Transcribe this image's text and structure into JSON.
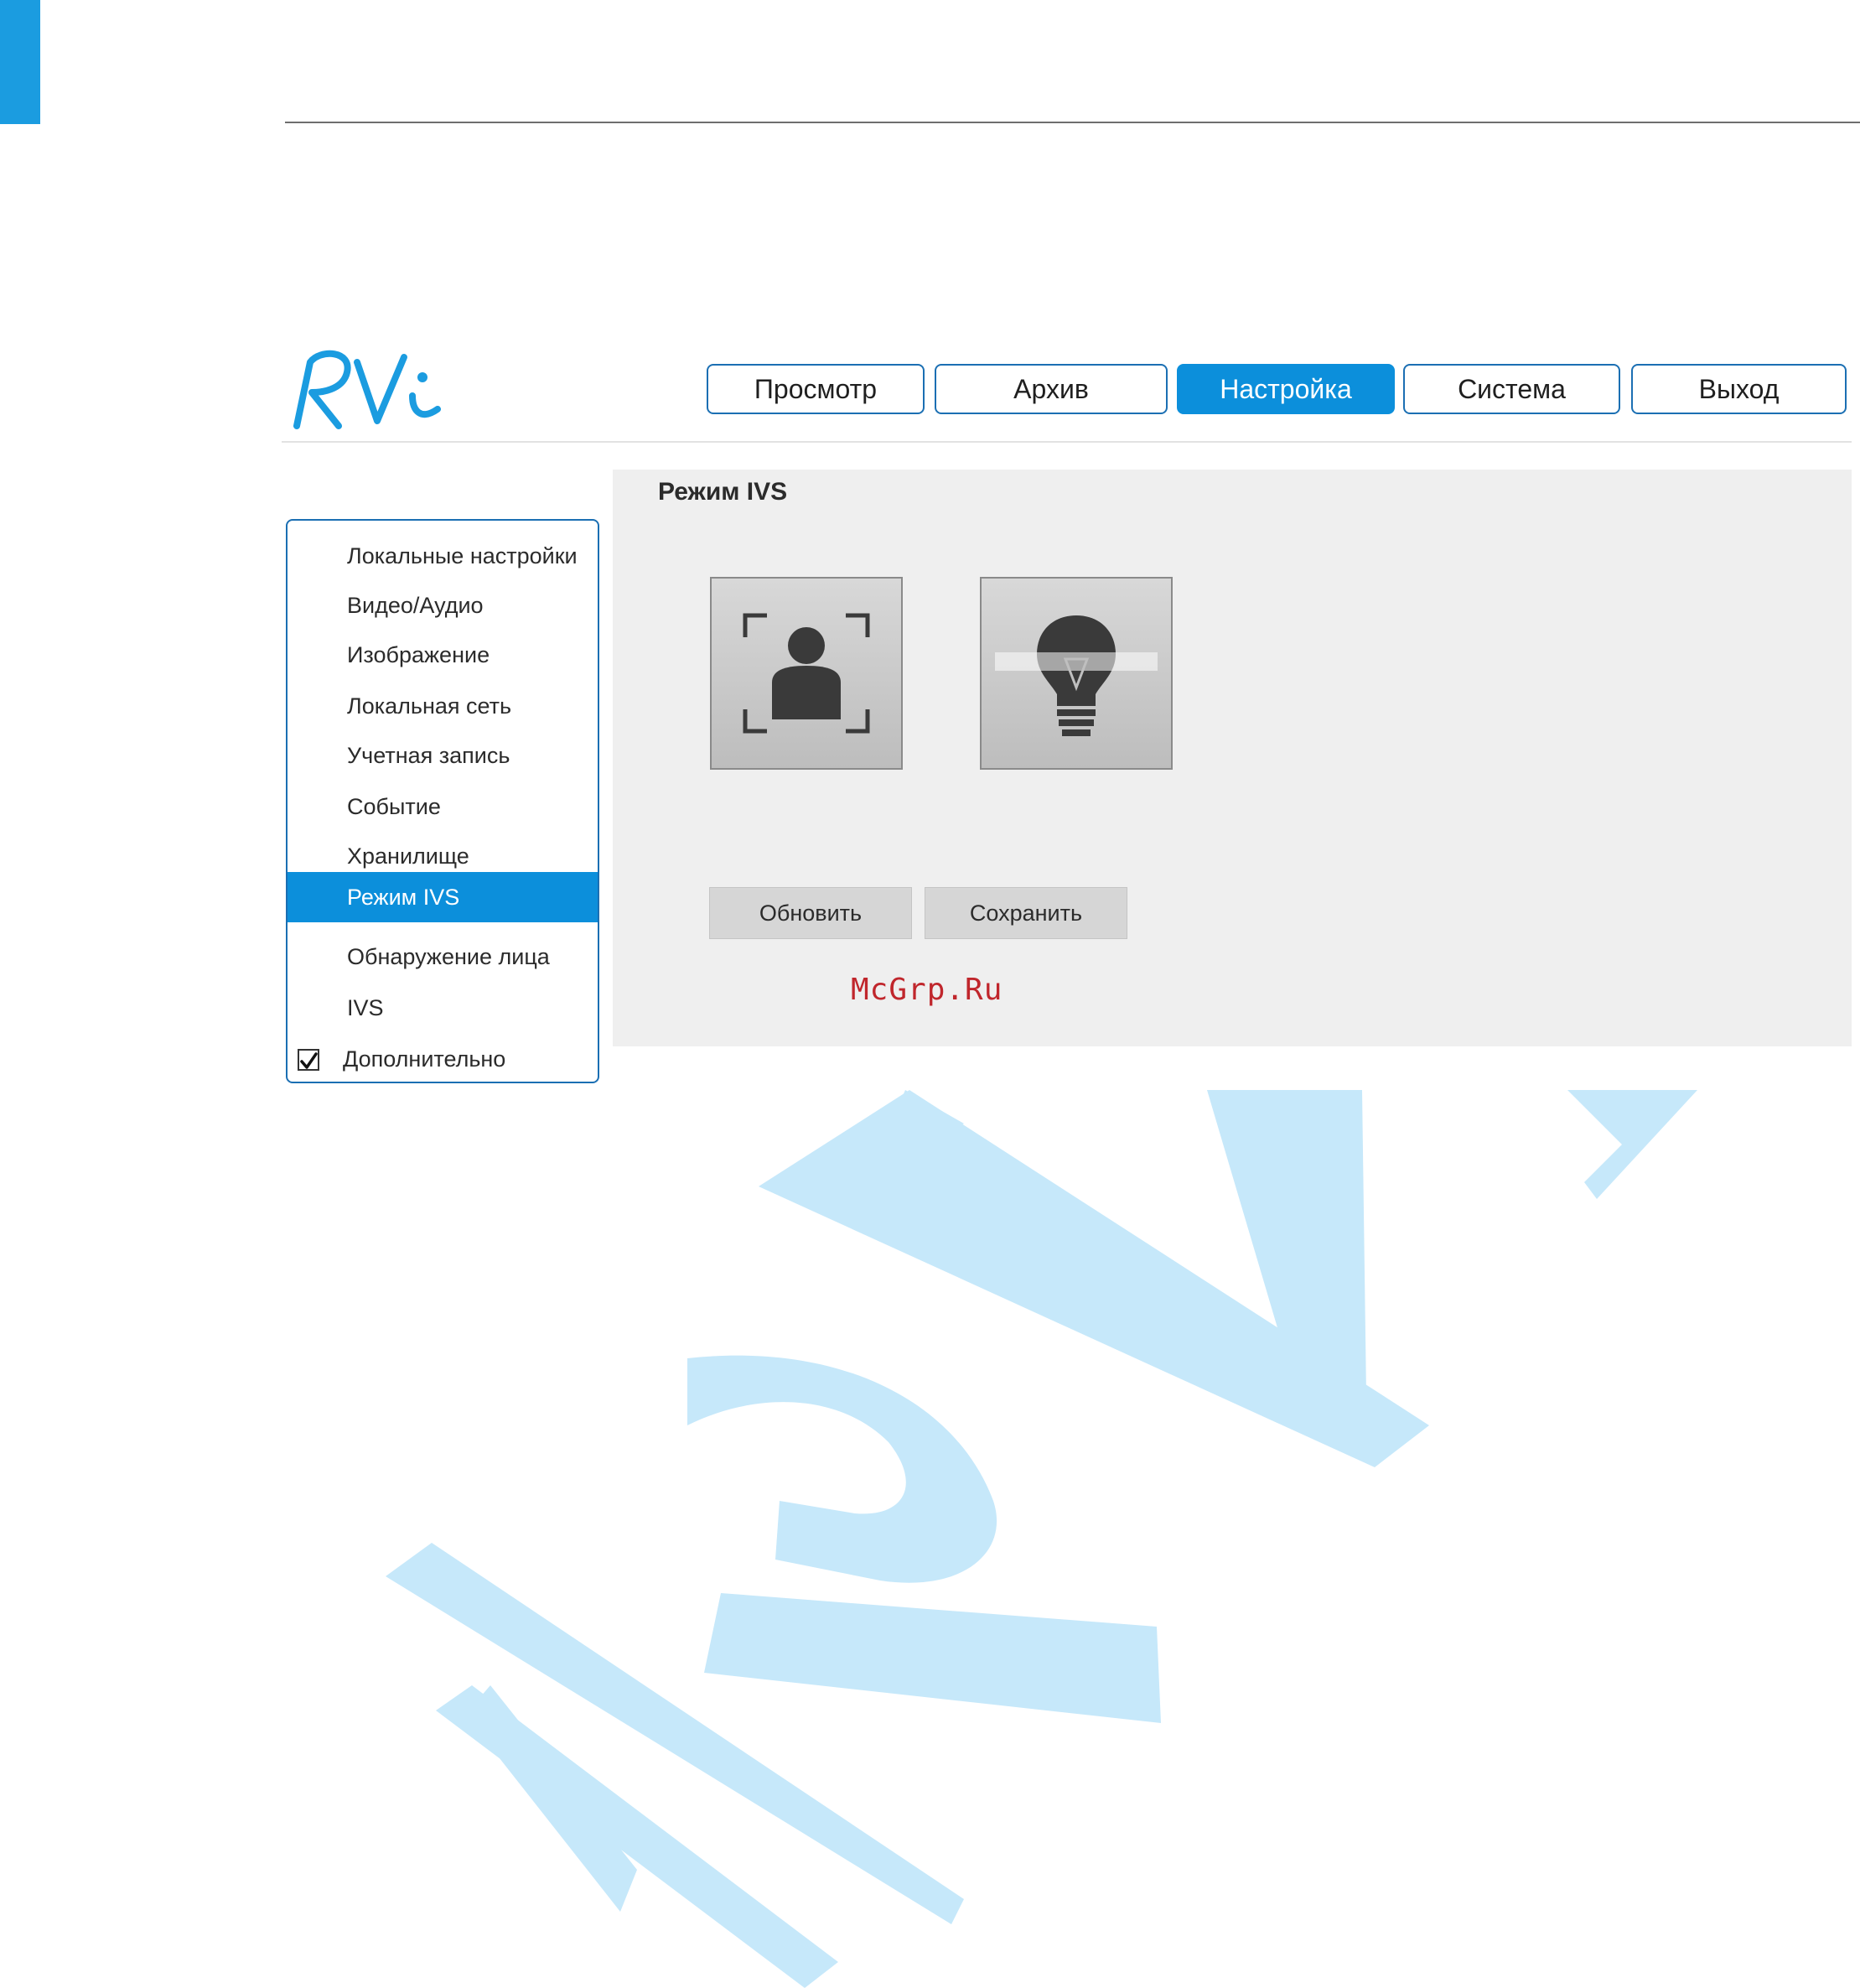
{
  "header": {
    "nav": [
      {
        "label": "Просмотр",
        "active": false
      },
      {
        "label": "Архив",
        "active": false
      },
      {
        "label": "Настройка",
        "active": true
      },
      {
        "label": "Система",
        "active": false
      },
      {
        "label": "Выход",
        "active": false
      }
    ]
  },
  "sidebar": {
    "items": [
      {
        "label": "Локальные настройки"
      },
      {
        "label": "Видео/Аудио"
      },
      {
        "label": "Изображение"
      },
      {
        "label": "Локальная сеть"
      },
      {
        "label": "Учетная запись"
      },
      {
        "label": "Событие"
      },
      {
        "label": "Хранилище"
      },
      {
        "label": "Режим IVS",
        "active": true
      },
      {
        "label": "Обнаружение лица"
      },
      {
        "label": "IVS"
      }
    ],
    "extra": {
      "label": "Дополнительно",
      "checked": true
    }
  },
  "main": {
    "title": "Режим IVS",
    "modes": [
      {
        "icon": "face-detection-icon"
      },
      {
        "icon": "ivs-bulb-icon"
      }
    ],
    "refresh_label": "Обновить",
    "save_label": "Сохранить"
  },
  "watermark_text": "McGrp.Ru",
  "colors": {
    "accent": "#0c8fdb",
    "watermark": "#c6e8fa",
    "mcgrp": "#c0262c"
  }
}
